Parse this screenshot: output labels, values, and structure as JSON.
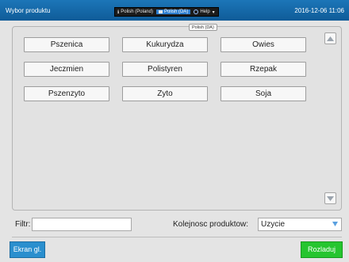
{
  "header": {
    "title": "Wybor produktu",
    "status": [
      {
        "label": "Polish (Poland)",
        "active": false
      },
      {
        "label": "Polish (DA)",
        "active": true
      },
      {
        "label": "Help",
        "active": false
      }
    ],
    "datetime": "2016-12-06 11:06"
  },
  "tooltip": "Polish (DA)",
  "products": [
    {
      "label": "Pszenica"
    },
    {
      "label": "Kukurydza"
    },
    {
      "label": "Owies"
    },
    {
      "label": "Jeczmien"
    },
    {
      "label": "Polistyren"
    },
    {
      "label": "Rzepak"
    },
    {
      "label": "Pszenzyto"
    },
    {
      "label": "Zyto"
    },
    {
      "label": "Soja"
    }
  ],
  "filter": {
    "label": "Filtr:",
    "value": ""
  },
  "order": {
    "label": "Kolejnosc produktow:",
    "selected": "Uzycie"
  },
  "footer": {
    "home_label": "Ekran gl.",
    "unload_label": "Rozladuj"
  },
  "colors": {
    "titlebar": "#1c76b8",
    "home": "#2a8fce",
    "unload": "#25c52f"
  }
}
